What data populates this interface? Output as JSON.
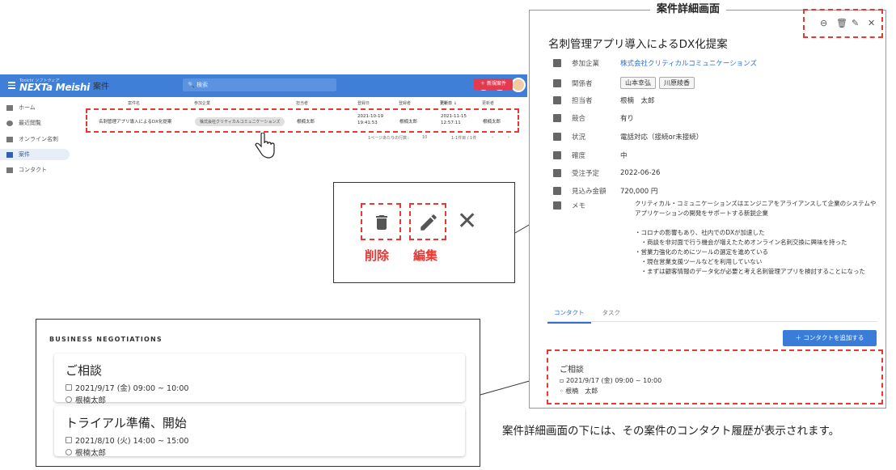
{
  "app": {
    "logo_small": "Tonichi ソフトウェア",
    "logo": "NEXTa Meishi",
    "search_placeholder": "検索",
    "nav": [
      {
        "label": "ホーム"
      },
      {
        "label": "最近閲覧"
      },
      {
        "label": "オンライン名刺"
      },
      {
        "label": "案件"
      },
      {
        "label": "コンタクト"
      }
    ],
    "page_heading": "案件",
    "new_button": "＋ 新規案件",
    "table_headers": [
      "案件名",
      "参加企業",
      "担当者",
      "登録日",
      "登録者",
      "更新日 ↓",
      "更新者"
    ],
    "row": {
      "name": "名刺管理アプリ導入によるDX化提案",
      "company": "株式会社クリティカルコミュニケーションズ",
      "owner": "根楠太郎",
      "created": "2021-10-19 19:41:53",
      "creator": "根楠太郎",
      "updated": "2021-11-15 12:57:11",
      "updater": "根楠太郎"
    },
    "pager_rows_label": "1ページあたりの行数：",
    "pager_rows": "10",
    "pager_range": "1-1件目 / 1件"
  },
  "zoom": {
    "delete_label": "削除",
    "edit_label": "編集"
  },
  "negotiations": {
    "title": "BUSINESS NEGOTIATIONS",
    "cards": [
      {
        "title": "ご相談",
        "date": "2021/9/17 (金) 09:00 ~ 10:00",
        "person": "根楠太郎"
      },
      {
        "title": "トライアル準備、開始",
        "date": "2021/8/10 (火) 14:00 ~ 15:00",
        "person": "根楠太郎"
      }
    ]
  },
  "detail": {
    "caption": "案件詳細画面",
    "title": "名刺管理アプリ導入によるDX化提案",
    "rows": [
      {
        "label": "参加企業",
        "value": "株式会社クリティカルコミュニケーションズ"
      },
      {
        "label": "関係者",
        "value": ""
      },
      {
        "label": "担当者",
        "value": "根楠　太郎"
      },
      {
        "label": "競合",
        "value": "有り"
      },
      {
        "label": "状況",
        "value": "電話対応（接続or未接続）"
      },
      {
        "label": "確度",
        "value": "中"
      },
      {
        "label": "受注予定",
        "value": "2022-06-26"
      },
      {
        "label": "見込み金額",
        "value": "720,000 円"
      },
      {
        "label": "メモ",
        "value": ""
      }
    ],
    "participants": [
      "山本幸弘",
      "川原綾香"
    ],
    "memo": "クリティカル・コミュニケーションズはエンジニアをアライアンスして企業のシステムやアプリケーションの開発をサポートする新鋭企業\n\n・コロナの影響もあり、社内でのDXが加速した\n　・商談を非対面で行う機会が増えたためオンライン名刺交換に興味を持った\n・営業力強化のためにツールの選定を進めている\n　・現在営業支援ツールなどを利用していない\n　・まずは顧客情報のデータ化が必要と考え名刺管理アプリを検討することになった",
    "tabs": [
      "コンタクト",
      "タスク"
    ],
    "add_contact": "＋ コンタクトを追加する",
    "contact": {
      "title": "ご相談",
      "date": "2021/9/17 (金) 09:00 ~ 10:00",
      "person": "根楠　太郎"
    }
  },
  "bottom_caption": "案件詳細画面の下には、その案件のコンタクト履歴が表示されます。",
  "colors": {
    "accent": "#e53935",
    "header": "#3f7fd8",
    "link": "#2f6fd1"
  }
}
